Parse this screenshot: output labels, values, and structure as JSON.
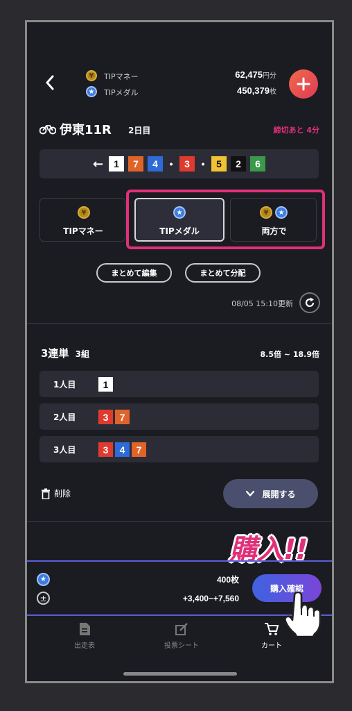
{
  "wallet": {
    "money_label": "TIPマネー",
    "money_value": "62,475",
    "money_unit": "円分",
    "medal_label": "TIPメダル",
    "medal_value": "450,379",
    "medal_unit": "枚"
  },
  "race": {
    "title": "伊東11R",
    "day": "2日目",
    "deadline": "締切あと 4分",
    "order_arrow": "←",
    "order": [
      {
        "n": "1",
        "bg": "#ffffff",
        "fg": "#111111"
      },
      {
        "n": "7",
        "bg": "#e0642a",
        "fg": "#ffffff"
      },
      {
        "n": "4",
        "bg": "#2f6bd8",
        "fg": "#ffffff"
      },
      {
        "n": "•",
        "bg": "transparent",
        "fg": "#ffffff"
      },
      {
        "n": "3",
        "bg": "#e03a2f",
        "fg": "#ffffff"
      },
      {
        "n": "•",
        "bg": "transparent",
        "fg": "#ffffff"
      },
      {
        "n": "5",
        "bg": "#f1c232",
        "fg": "#111111"
      },
      {
        "n": "2",
        "bg": "#111111",
        "fg": "#ffffff"
      },
      {
        "n": "6",
        "bg": "#3a9a4a",
        "fg": "#ffffff"
      }
    ]
  },
  "pay": {
    "money": "TIPマネー",
    "medal": "TIPメダル",
    "both": "両方で"
  },
  "actions": {
    "bulk_edit": "まとめて編集",
    "bulk_split": "まとめて分配",
    "updated": "08/05 15:10更新"
  },
  "bet": {
    "type": "3連単",
    "combos": "3組",
    "odds": "8.5倍 ~ 18.9倍",
    "rows": [
      {
        "label": "1人目",
        "picks": [
          {
            "n": "1",
            "bg": "#ffffff",
            "fg": "#111111"
          }
        ]
      },
      {
        "label": "2人目",
        "picks": [
          {
            "n": "3",
            "bg": "#e03a2f",
            "fg": "#ffffff"
          },
          {
            "n": "7",
            "bg": "#e0642a",
            "fg": "#ffffff"
          }
        ]
      },
      {
        "label": "3人目",
        "picks": [
          {
            "n": "3",
            "bg": "#e03a2f",
            "fg": "#ffffff"
          },
          {
            "n": "4",
            "bg": "#2f6bd8",
            "fg": "#ffffff"
          },
          {
            "n": "7",
            "bg": "#e0642a",
            "fg": "#ffffff"
          }
        ]
      }
    ],
    "delete": "削除",
    "expand": "展開する"
  },
  "footer": {
    "callout": "購入!!",
    "medals": "400枚",
    "range": "+3,400~+7,560",
    "confirm": "購入確認"
  },
  "nav": {
    "items": [
      "出走表",
      "投票シート",
      "カート"
    ]
  },
  "colors": {
    "accent": "#e0307a",
    "purple": "#5b4fd8",
    "deadline": "#e0307a"
  }
}
